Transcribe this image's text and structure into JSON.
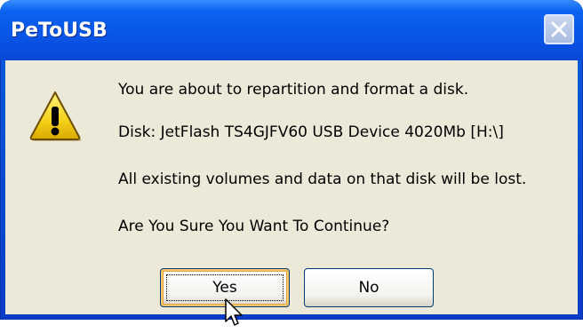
{
  "window": {
    "title": "PeToUSB",
    "close_icon": "close-icon"
  },
  "message": {
    "icon": "warning-icon",
    "line1": "You are about to repartition and format a disk.",
    "line2": "Disk: JetFlash TS4GJFV60 USB Device 4020Mb [H:\\]",
    "line3": "All existing volumes and data on that disk will be lost.",
    "line4": "Are You Sure You Want To Continue?"
  },
  "buttons": {
    "yes_label": "Yes",
    "no_label": "No"
  },
  "colors": {
    "titlebar": "#0a55e6",
    "client_bg": "#ece9d8",
    "warning_yellow": "#f5d21b",
    "focus_border": "#e8a43a"
  },
  "cursor": "pointer-cursor-icon"
}
